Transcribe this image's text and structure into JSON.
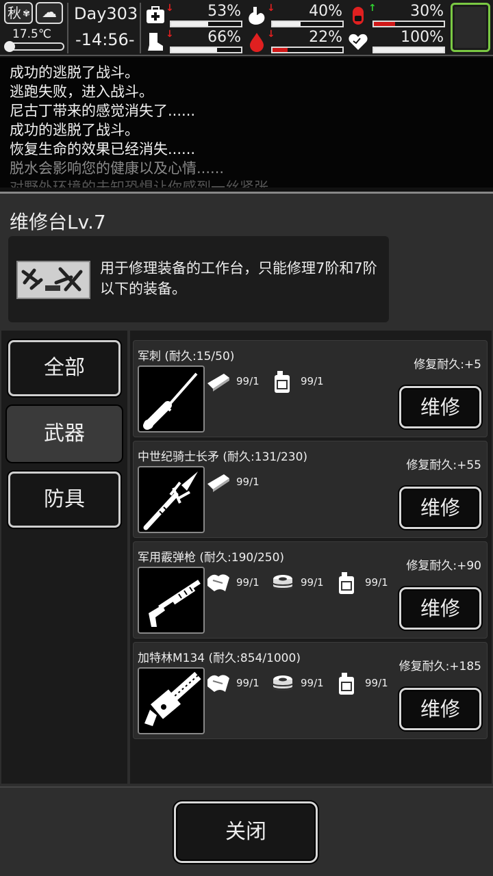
{
  "status": {
    "season": "秋",
    "season_icon": "leaf-icon",
    "weather_icon": "cloud-icon",
    "temperature": "17.5℃",
    "day": "Day303",
    "time": "-14:56-",
    "stats": [
      {
        "id": "health",
        "icon": "medkit-icon",
        "trend": "down",
        "percent_text": "53%",
        "value": 53
      },
      {
        "id": "hunger",
        "icon": "stomach-icon",
        "trend": "down",
        "percent_text": "40%",
        "value": 40
      },
      {
        "id": "infection",
        "icon": "pill-icon",
        "trend": "up",
        "percent_text": "30%",
        "value": 30
      },
      {
        "id": "stamina",
        "icon": "boot-icon",
        "trend": "down",
        "percent_text": "66%",
        "value": 66
      },
      {
        "id": "thirst",
        "icon": "blood-drop-icon",
        "trend": "down",
        "percent_text": "22%",
        "value": 22
      },
      {
        "id": "mood",
        "icon": "heart-icon",
        "trend": "none",
        "percent_text": "100%",
        "value": 100
      }
    ],
    "colors": {
      "down": "#e02020",
      "up": "#2fcf2f",
      "bar_white": "#f0f0f0",
      "bar_red": "#d01818",
      "portrait_border": "#7ac943"
    }
  },
  "log": [
    "成功的逃脱了战斗。",
    "逃跑失败，进入战斗。",
    "尼古丁带来的感觉消失了......",
    "成功的逃脱了战斗。",
    "恢复生命的效果已经消失......",
    "脱水会影响您的健康以及心情......",
    "对野外环境的未知恐惧让你感到一丝紧张......"
  ],
  "panel": {
    "title": "维修台Lv.7",
    "description": "用于修理装备的工作台，只能修理7阶和7阶以下的装备。",
    "tabs": [
      "全部",
      "武器",
      "防具"
    ],
    "active_tab": 1,
    "items": [
      {
        "name": "军刺 (耐久:15/50)",
        "icon": "bayonet-icon",
        "bonus": "修复耐久:+5",
        "materials": [
          {
            "icon": "whetstone-icon",
            "text": "99/1"
          },
          {
            "icon": "oil-can-icon",
            "text": "99/1"
          }
        ]
      },
      {
        "name": "中世纪骑士长矛 (耐久:131/230)",
        "icon": "spear-icon",
        "bonus": "修复耐久:+55",
        "materials": [
          {
            "icon": "whetstone-icon",
            "text": "99/1"
          }
        ]
      },
      {
        "name": "军用霰弹枪 (耐久:190/250)",
        "icon": "shotgun-icon",
        "bonus": "修复耐久:+90",
        "materials": [
          {
            "icon": "cloth-icon",
            "text": "99/1"
          },
          {
            "icon": "tape-icon",
            "text": "99/1"
          },
          {
            "icon": "oil-can-icon",
            "text": "99/1"
          }
        ]
      },
      {
        "name": "加特林M134 (耐久:854/1000)",
        "icon": "minigun-icon",
        "bonus": "修复耐久:+185",
        "materials": [
          {
            "icon": "cloth-icon",
            "text": "99/1"
          },
          {
            "icon": "tape-icon",
            "text": "99/1"
          },
          {
            "icon": "oil-can-icon",
            "text": "99/1"
          }
        ]
      }
    ],
    "repair_label": "维修",
    "close_label": "关闭"
  }
}
